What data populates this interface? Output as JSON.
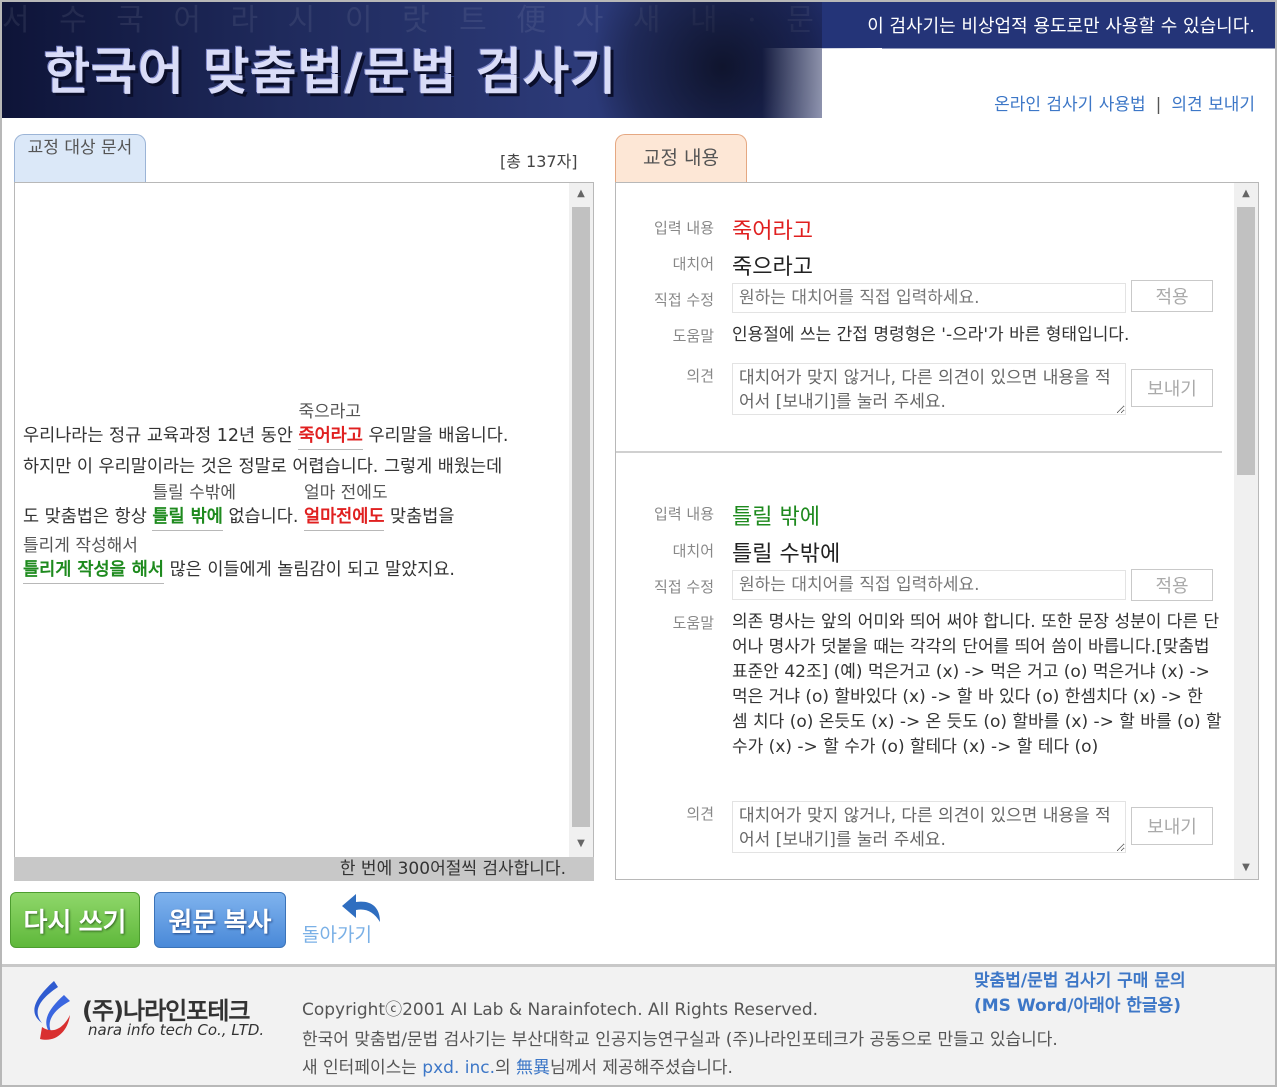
{
  "header": {
    "title": "한국어 맞춤법/문법 검사기",
    "background_glyphs": "서 수 국 어 라 시 이 랏 트 便 사 새 내 · 문 혹 · 분 한 · 생 라 본 도 · 너 늘 에 종 의 · 탐 진",
    "notice": "이 검사기는 비상업적 용도로만 사용할 수 있습니다.",
    "link_usage": "온라인 검사기 사용법",
    "separator": "|",
    "link_feedback": "의견 보내기"
  },
  "left": {
    "tab_label": "교정 대상 문서",
    "char_count": "[총 137자]",
    "document": {
      "l1_a": "우리나라는 정규 교육과정 12년 동안 ",
      "c1": "죽어라고",
      "c1_sugg": "죽으라고",
      "l1_b": " 우리말을 배웁니다.",
      "l2": "하지만 이 우리말이라는 것은 정말로 어렵습니다. 그렇게 배웠는데",
      "l3_a": "도 맞춤법은 항상 ",
      "c2": "틀릴 밖에",
      "c2_sugg": "틀릴 수밖에",
      "l3_b": " 없습니다. ",
      "c3": "얼마전에도",
      "c3_sugg": "얼마 전에도",
      "l3_c": " 맞춤법을",
      "c4": "틀리게 작성을 해서",
      "c4_sugg": "틀리게 작성해서",
      "l4_b": " 많은 이들에게 놀림감이 되고 말았지요."
    },
    "status": "한 번에 300어절씩 검사합니다."
  },
  "buttons": {
    "rewrite": "다시 쓰기",
    "copy": "원문 복사",
    "back": "돌아가기"
  },
  "right": {
    "tab_label": "교정 내용",
    "labels": {
      "input": "입력 내용",
      "substitute": "대치어",
      "direct": "직접 수정",
      "help": "도움말",
      "opinion": "의견"
    },
    "direct_placeholder": "원하는 대치어를 직접 입력하세요.",
    "apply_label": "적용",
    "opinion_placeholder": "대치어가 맞지 않거나, 다른 의견이 있으면 내용을 적어서 [보내기]를 눌러 주세요.",
    "send_label": "보내기",
    "entries": [
      {
        "input": "죽어라고",
        "substitute": "죽으라고",
        "help": "인용절에 쓰는 간접 명령형은 '-으라'가 바른 형태입니다."
      },
      {
        "input": "틀릴 밖에",
        "substitute": "틀릴 수밖에",
        "help": "의존 명사는 앞의 어미와 띄어 써야 합니다. 또한 문장 성분이 다른 단어나 명사가 덧붙을 때는 각각의 단어를 띄어 씀이 바릅니다.[맞춤법 표준안 42조] (예) 먹은거고 (x) -> 먹은 거고 (o) 먹은거냐 (x) -> 먹은 거냐 (o) 할바있다 (x) -> 할 바 있다 (o) 한셈치다 (x) -> 한 셈 치다 (o) 온듯도 (x) -> 온 듯도 (o) 할바를 (x) -> 할 바를 (o) 할수가 (x) -> 할 수가 (o) 할테다 (x) -> 할 테다 (o)"
      }
    ]
  },
  "footer": {
    "company_ko": "(주)나라인포테크",
    "company_en": "nara info tech Co., LTD.",
    "copyright": "Copyrightⓒ2001 AI Lab & Narainfotech. All Rights Reserved.",
    "credit1": "한국어 맞춤법/문법 검사기는 부산대학교 인공지능연구실과 (주)나라인포테크가 공동으로 만들고 있습니다.",
    "credit2_a": "새 인터페이스는 ",
    "credit2_link1": "pxd. inc.",
    "credit2_b": "의 ",
    "credit2_link2": "無異",
    "credit2_c": "님께서 제공해주셨습니다.",
    "buy_line1": "맞춤법/문법 검사기 구매 문의",
    "buy_line2": "(MS Word/아래아 한글용)"
  },
  "colors": {
    "error_red": "#e02020",
    "error_green": "#1e8a1e",
    "link_blue": "#3d77c7",
    "header_navy": "#243478"
  }
}
